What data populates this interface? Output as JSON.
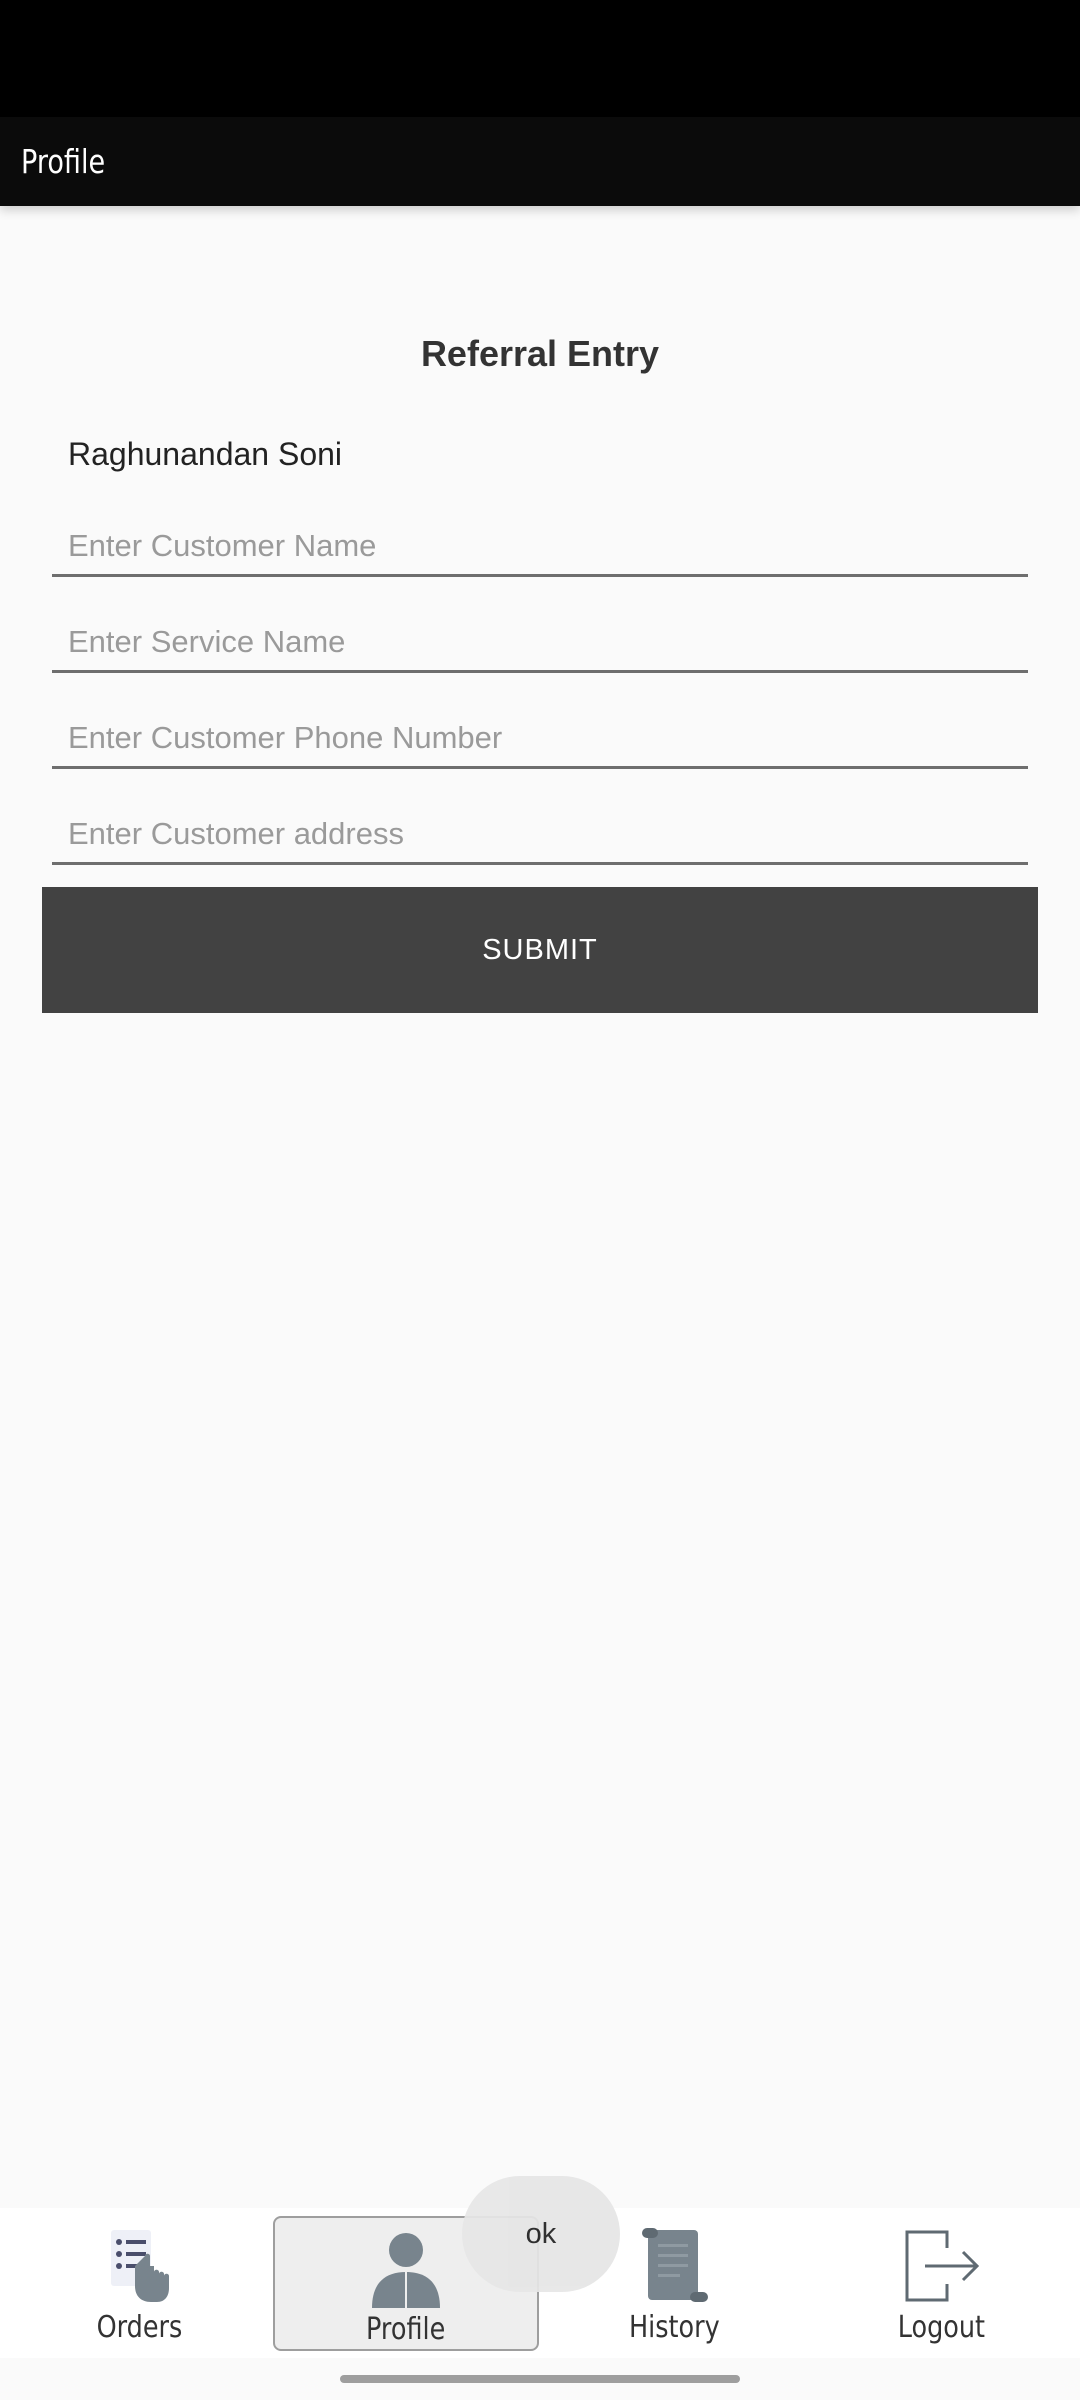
{
  "app_bar": {
    "title": "Profile"
  },
  "form": {
    "title": "Referral Entry",
    "user_name": "Raghunandan Soni",
    "customer_name": {
      "value": "",
      "placeholder": "Enter Customer Name"
    },
    "service_name": {
      "value": "",
      "placeholder": "Enter Service Name"
    },
    "customer_phone": {
      "value": "",
      "placeholder": "Enter Customer Phone Number"
    },
    "customer_address": {
      "value": "",
      "placeholder": "Enter Customer address"
    },
    "submit_label": "SUBMIT"
  },
  "nav": {
    "items": [
      {
        "label": "Orders",
        "icon": "orders-list-icon"
      },
      {
        "label": "Profile",
        "icon": "person-icon",
        "active": true
      },
      {
        "label": "History",
        "icon": "scroll-icon"
      },
      {
        "label": "Logout",
        "icon": "logout-icon"
      }
    ]
  },
  "toast": {
    "text": "ok"
  },
  "colors": {
    "app_bar": "#0b0b0b",
    "background": "#fafafa",
    "button": "#424242",
    "icon_gray": "#78848d"
  }
}
